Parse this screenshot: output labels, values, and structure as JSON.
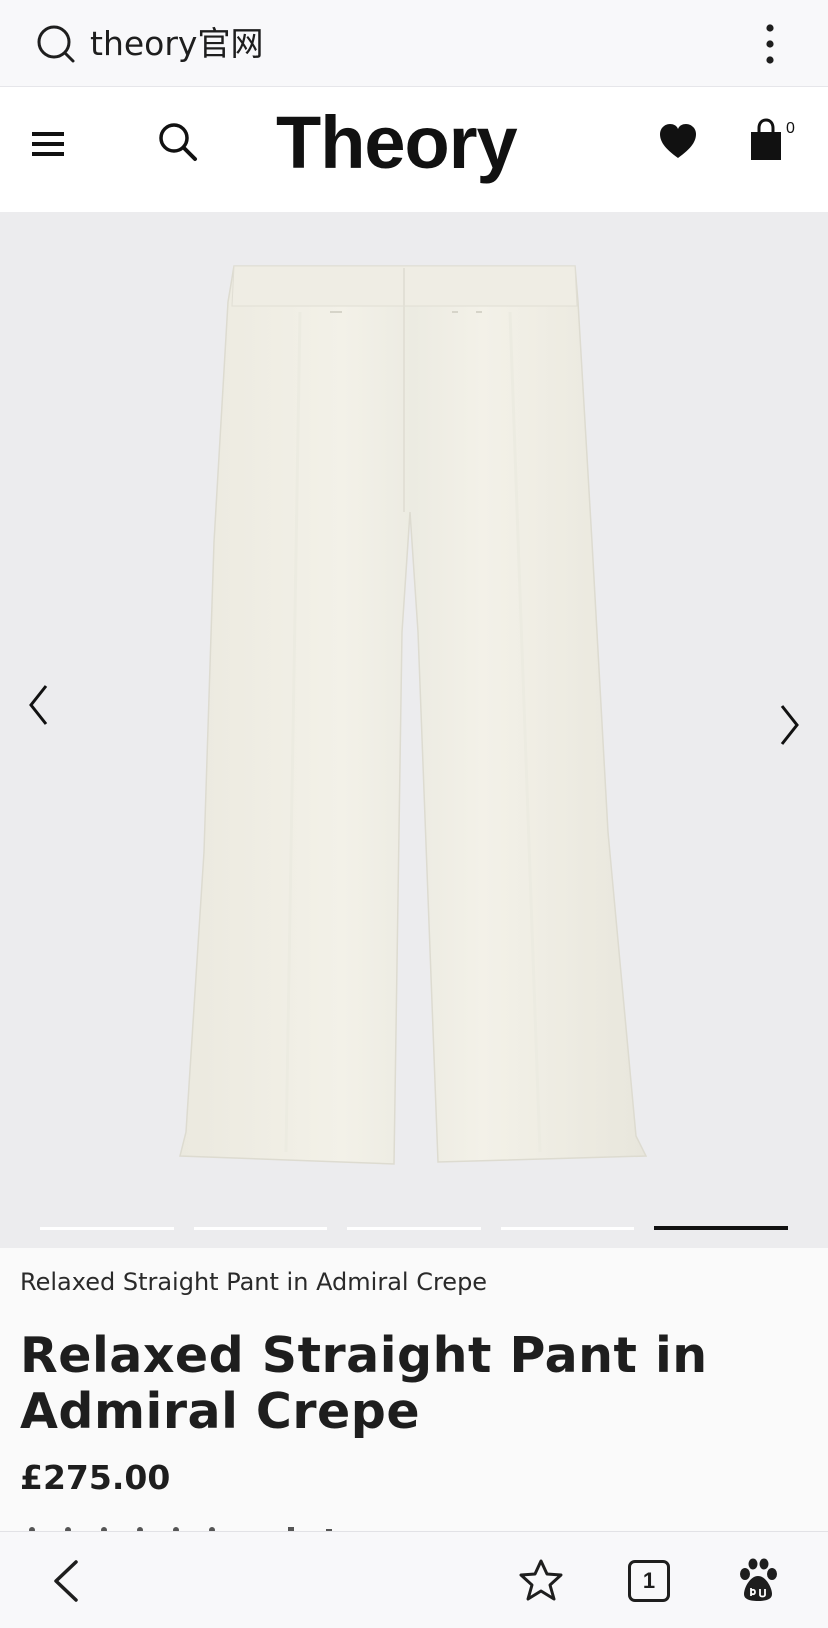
{
  "browser": {
    "query": "theory官网",
    "tab_count": "1"
  },
  "site": {
    "logo": "Theory",
    "bag_count": "0"
  },
  "gallery": {
    "image_count": 5,
    "active_index": 4
  },
  "product": {
    "breadcrumb": "Relaxed Straight Pant in Admiral Crepe",
    "title": "Relaxed Straight Pant in Admiral Crepe",
    "price": "£275.00"
  },
  "icons": {
    "browser_search": "search-icon",
    "browser_menu": "more-vertical-icon",
    "menu": "hamburger-icon",
    "site_search": "search-icon",
    "wishlist": "heart-icon",
    "bag": "shopping-bag-icon",
    "prev": "chevron-left-icon",
    "next": "chevron-right-icon",
    "back": "back-arrow-icon",
    "favorite": "star-icon",
    "baidu": "baidu-paw-icon"
  },
  "colors": {
    "gallery_bg": "#ececee",
    "garment": "#f1efe6",
    "text": "#1e1e1e"
  }
}
